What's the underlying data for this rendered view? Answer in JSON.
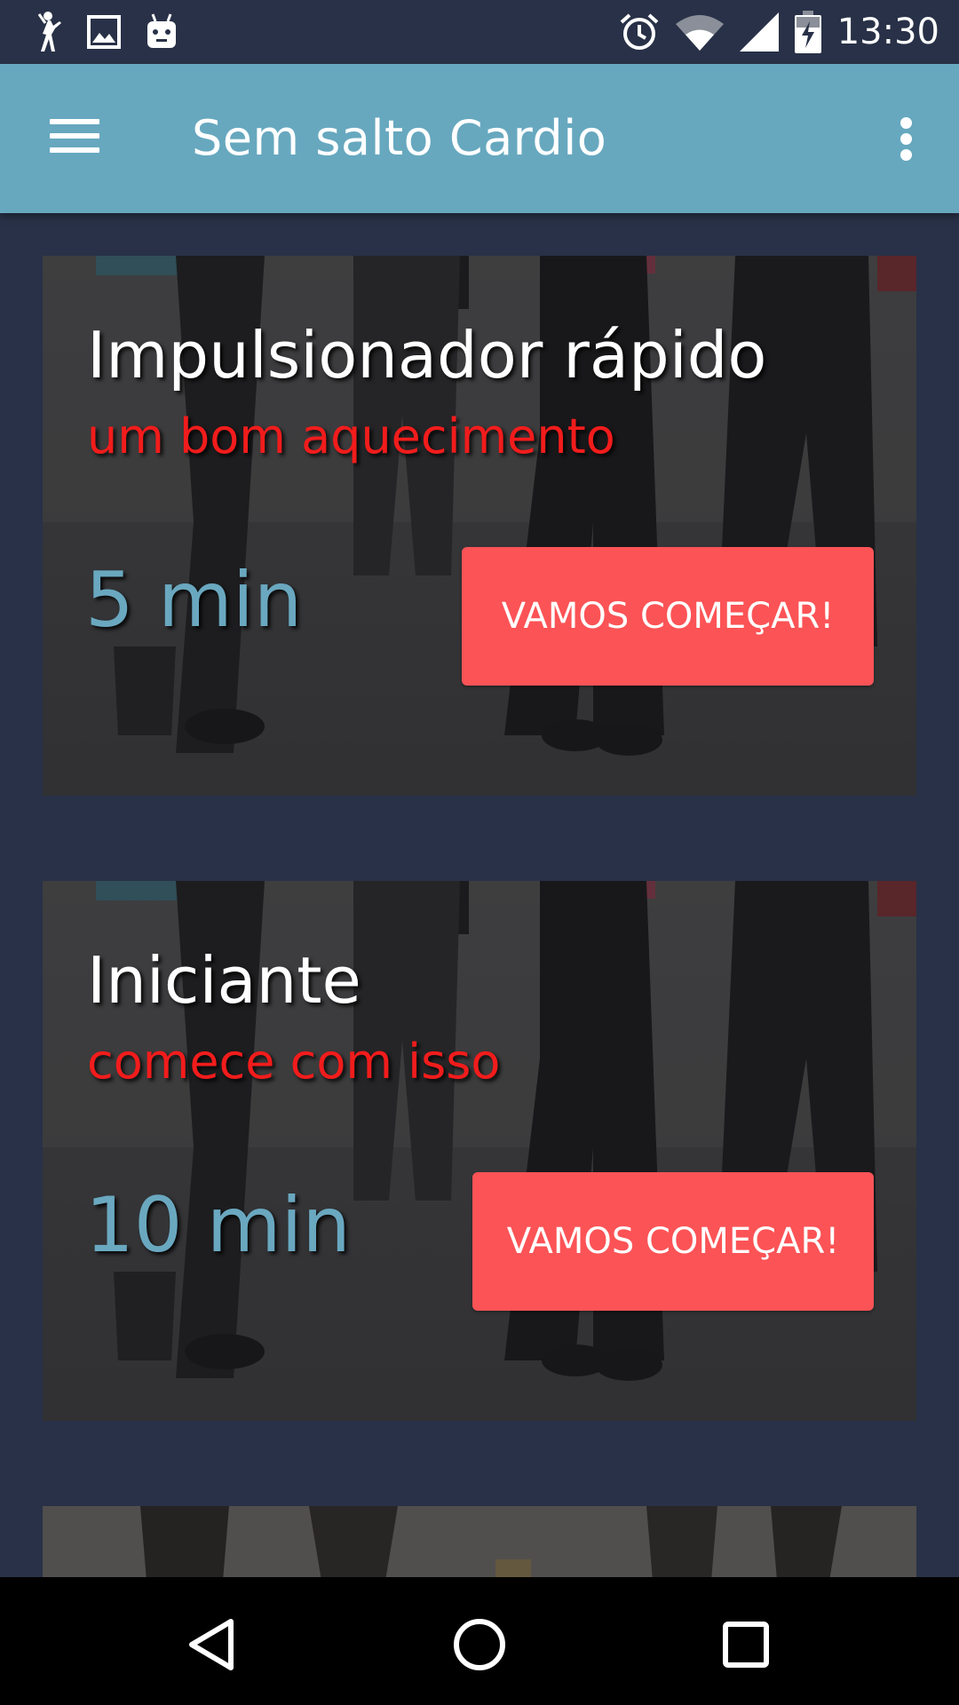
{
  "status_bar": {
    "time": "13:30",
    "left_icons": [
      "dancer-icon",
      "image-icon",
      "android-icon"
    ],
    "right_icons": [
      "alarm-icon",
      "wifi-icon",
      "signal-icon",
      "battery-charging-icon"
    ]
  },
  "app_bar": {
    "title": "Sem salto Cardio",
    "menu_icon": "hamburger-menu-icon",
    "overflow_icon": "more-vert-icon"
  },
  "cards": [
    {
      "title": "Impulsionador rápido",
      "subtitle": "um bom aquecimento",
      "duration": "5 min",
      "button_label": "VAMOS COMEÇAR!"
    },
    {
      "title": "Iniciante",
      "subtitle": "comece com isso",
      "duration": "10 min",
      "button_label": "VAMOS COMEÇAR!"
    }
  ],
  "nav_bar": {
    "icons": [
      "back-icon",
      "home-icon",
      "recents-icon"
    ]
  },
  "colors": {
    "background": "#283147",
    "app_bar": "#67a8bf",
    "button": "#fc5356",
    "subtitle": "#f21c1c",
    "duration": "#6aa8c0"
  }
}
